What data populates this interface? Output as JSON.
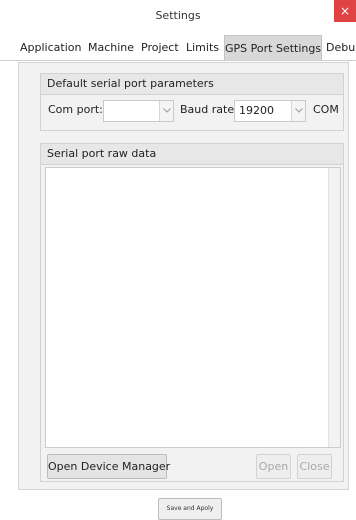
{
  "window": {
    "title": "Settings",
    "close_glyph": "×"
  },
  "tabs": [
    {
      "label": "Application",
      "active": false
    },
    {
      "label": "Machine",
      "active": false
    },
    {
      "label": "Project",
      "active": false
    },
    {
      "label": "Limits",
      "active": false
    },
    {
      "label": "GPS Port Settings",
      "active": true
    },
    {
      "label": "Debu",
      "active": false
    }
  ],
  "defaults_group": {
    "title": "Default serial port parameters",
    "com_port_label": "Com port:",
    "com_port_value": "",
    "baud_rate_label": "Baud rate:",
    "baud_rate_value": "19200",
    "com_suffix": "COM"
  },
  "raw_data_group": {
    "title": "Serial port raw data",
    "content": ""
  },
  "buttons": {
    "open_device_manager": "Open Device Manager",
    "open": "Open",
    "close": "Close",
    "save_and_apply": "Save and Apoly"
  },
  "icons": {
    "dropdown": "chevron-down-icon",
    "close": "close-icon"
  },
  "colors": {
    "close_button": "#e04343",
    "active_tab": "#d8d8d8",
    "panel_background": "#f2f2f2"
  }
}
